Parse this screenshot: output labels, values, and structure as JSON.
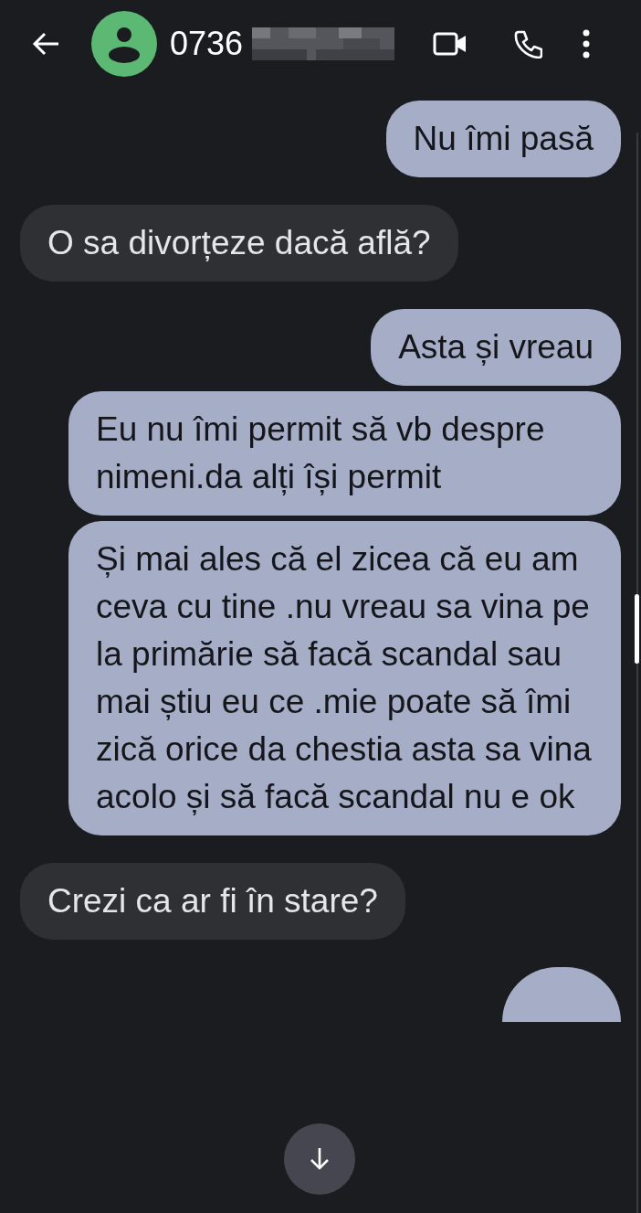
{
  "header": {
    "contact": "0736",
    "number_redacted": true
  },
  "messages": [
    {
      "kind": "sent",
      "text": "Nu îmi pasă"
    },
    {
      "kind": "received",
      "text": "O sa divorțeze dacă află?"
    },
    {
      "kind": "sent",
      "text": "Asta și vreau"
    },
    {
      "kind": "sent",
      "text": "Eu nu îmi permit să vb despre nimeni.da alți își permit"
    },
    {
      "kind": "sent",
      "text": "Și mai ales că el zicea că eu am ceva cu tine .nu vreau sa vina pe la primărie să facă scandal sau mai știu eu ce .mie poate să îmi zică orice da chestia asta sa vina acolo și să facă scandal nu e ok"
    },
    {
      "kind": "received",
      "text": "Crezi ca ar fi în stare?"
    },
    {
      "kind": "sent_partial"
    }
  ]
}
